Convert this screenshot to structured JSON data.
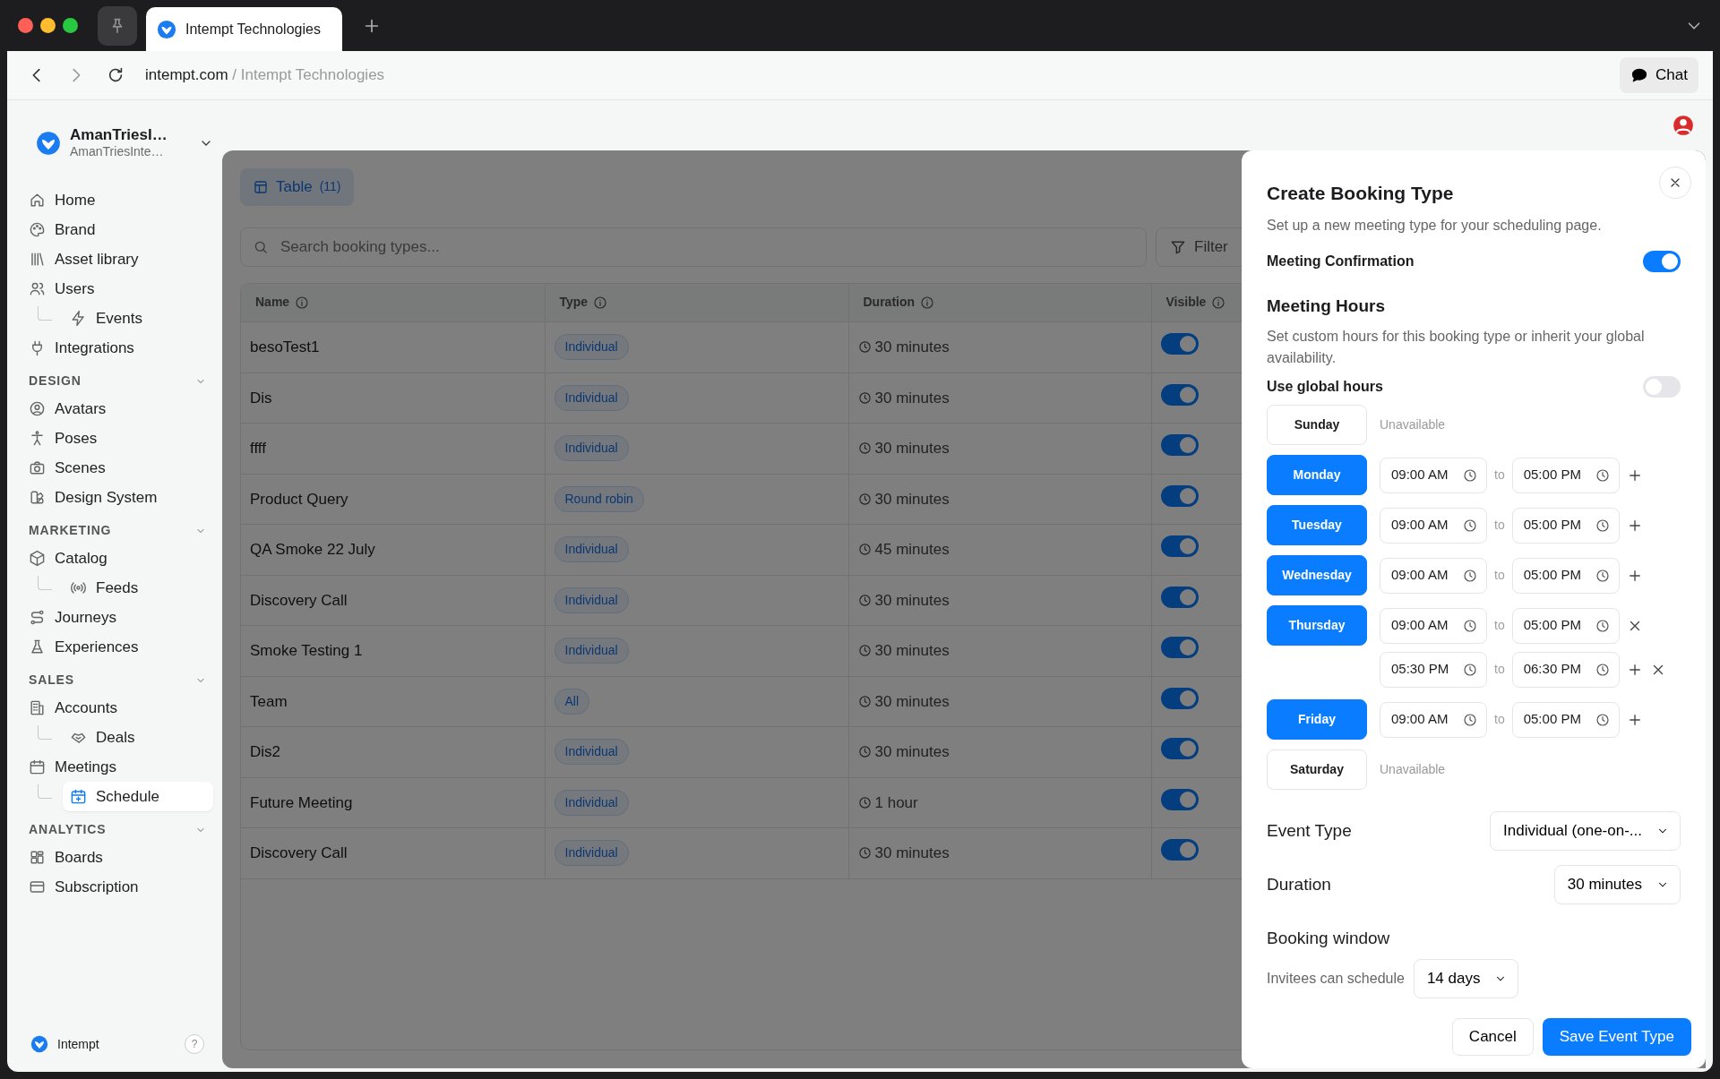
{
  "browser": {
    "tab_title": "Intempt Technologies",
    "url_domain": "intempt.com",
    "url_separator": "/",
    "url_title": "Intempt Technologies",
    "chat_button": "Chat"
  },
  "sidebar": {
    "account": {
      "name": "AmanTriesI…",
      "subtitle": "AmanTriesInte…"
    },
    "sections": [
      {
        "items": [
          {
            "label": "Home",
            "selected": false
          },
          {
            "label": "Brand",
            "selected": false
          },
          {
            "label": "Asset library",
            "selected": false
          },
          {
            "label": "Users",
            "selected": false,
            "children": [
              {
                "label": "Events",
                "selected": false
              }
            ]
          },
          {
            "label": "Integrations",
            "selected": false
          }
        ]
      },
      {
        "heading": "DESIGN",
        "items": [
          {
            "label": "Avatars",
            "selected": false
          },
          {
            "label": "Poses",
            "selected": false
          },
          {
            "label": "Scenes",
            "selected": false
          },
          {
            "label": "Design System",
            "selected": false
          }
        ]
      },
      {
        "heading": "MARKETING",
        "items": [
          {
            "label": "Catalog",
            "selected": false,
            "children": [
              {
                "label": "Feeds",
                "selected": false
              }
            ]
          },
          {
            "label": "Journeys",
            "selected": false
          },
          {
            "label": "Experiences",
            "selected": false
          }
        ]
      },
      {
        "heading": "SALES",
        "items": [
          {
            "label": "Accounts",
            "selected": false,
            "children": [
              {
                "label": "Deals",
                "selected": false
              }
            ]
          },
          {
            "label": "Meetings",
            "selected": false,
            "children": [
              {
                "label": "Schedule",
                "selected": true
              }
            ]
          }
        ]
      },
      {
        "heading": "ANALYTICS",
        "items": [
          {
            "label": "Boards",
            "selected": false
          },
          {
            "label": "Subscription",
            "selected": false
          }
        ]
      }
    ],
    "footer": {
      "label": "Intempt",
      "help": "?"
    }
  },
  "table": {
    "view_button": {
      "label": "Table",
      "count": "(11)"
    },
    "search": {
      "placeholder": "Search booking types..."
    },
    "filter_button": "Filter",
    "columns": [
      "Name",
      "Type",
      "Duration",
      "Visible"
    ],
    "rows": [
      {
        "name": "besoTest1",
        "type": "Individual",
        "duration": "30 minutes",
        "visible": true
      },
      {
        "name": "Dis",
        "type": "Individual",
        "duration": "30 minutes",
        "visible": true
      },
      {
        "name": "ffff",
        "type": "Individual",
        "duration": "30 minutes",
        "visible": true
      },
      {
        "name": "Product Query",
        "type": "Round robin",
        "duration": "30 minutes",
        "visible": true
      },
      {
        "name": "QA Smoke 22 July",
        "type": "Individual",
        "duration": "45 minutes",
        "visible": true
      },
      {
        "name": "Discovery Call",
        "type": "Individual",
        "duration": "30 minutes",
        "visible": true
      },
      {
        "name": "Smoke Testing 1",
        "type": "Individual",
        "duration": "30 minutes",
        "visible": true
      },
      {
        "name": "Team",
        "type": "All",
        "duration": "30 minutes",
        "visible": true
      },
      {
        "name": "Dis2",
        "type": "Individual",
        "duration": "30 minutes",
        "visible": true
      },
      {
        "name": "Future Meeting",
        "type": "Individual",
        "duration": "1 hour",
        "visible": true
      },
      {
        "name": "Discovery Call",
        "type": "Individual",
        "duration": "30 minutes",
        "visible": true
      }
    ]
  },
  "drawer": {
    "title": "Create Booking Type",
    "subtitle": "Set up a new meeting type for your scheduling page.",
    "meeting_confirmation": {
      "label": "Meeting Confirmation",
      "on": true
    },
    "meeting_hours": {
      "heading": "Meeting Hours",
      "description": "Set custom hours for this booking type or inherit your global availability."
    },
    "use_global_hours": {
      "label": "Use global hours",
      "on": false
    },
    "days": [
      {
        "label": "Sunday",
        "available": false,
        "status": "Unavailable"
      },
      {
        "label": "Monday",
        "available": true,
        "slots": [
          {
            "start": "09:00 AM",
            "separator": "to",
            "end": "05:00 PM",
            "can_add": true,
            "can_remove": false
          }
        ]
      },
      {
        "label": "Tuesday",
        "available": true,
        "slots": [
          {
            "start": "09:00 AM",
            "separator": "to",
            "end": "05:00 PM",
            "can_add": true,
            "can_remove": false
          }
        ]
      },
      {
        "label": "Wednesday",
        "available": true,
        "slots": [
          {
            "start": "09:00 AM",
            "separator": "to",
            "end": "05:00 PM",
            "can_add": true,
            "can_remove": false
          }
        ]
      },
      {
        "label": "Thursday",
        "available": true,
        "slots": [
          {
            "start": "09:00 AM",
            "separator": "to",
            "end": "05:00 PM",
            "can_add": false,
            "can_remove": true
          },
          {
            "start": "05:30 PM",
            "separator": "to",
            "end": "06:30 PM",
            "can_add": true,
            "can_remove": true
          }
        ]
      },
      {
        "label": "Friday",
        "available": true,
        "slots": [
          {
            "start": "09:00 AM",
            "separator": "to",
            "end": "05:00 PM",
            "can_add": true,
            "can_remove": false
          }
        ]
      },
      {
        "label": "Saturday",
        "available": false,
        "status": "Unavailable"
      }
    ],
    "event_type": {
      "label": "Event Type",
      "value": "Individual (one-on-..."
    },
    "duration": {
      "label": "Duration",
      "value": "30 minutes"
    },
    "booking_window": {
      "heading": "Booking window",
      "label": "Invitees can schedule",
      "value": "14 days"
    },
    "buttons": {
      "cancel": "Cancel",
      "save": "Save Event Type"
    }
  }
}
